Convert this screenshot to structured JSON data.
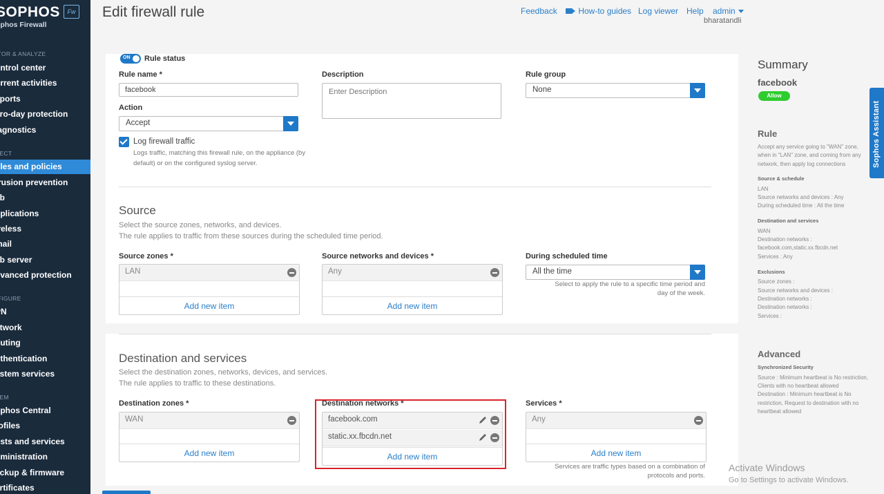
{
  "sidebar": {
    "brand": "SOPHOS",
    "badge": "Fw",
    "subtitle": "ophos Firewall",
    "sections": [
      "ITOR & ANALYZE",
      "TECT",
      "IFIGURE",
      "TEM"
    ],
    "items": [
      "ontrol center",
      "urrent activities",
      "eports",
      "ero-day protection",
      "iagnostics",
      "ules and policies",
      "trusion prevention",
      "eb",
      "pplications",
      "ireless",
      "mail",
      "eb server",
      "dvanced protection",
      "PN",
      "etwork",
      "outing",
      "uthentication",
      "ystem services",
      "ophos Central",
      "rofiles",
      "osts and services",
      "dministration",
      "ackup & firmware",
      "ertificates"
    ]
  },
  "header": {
    "title": "Edit firewall rule",
    "feedback": "Feedback",
    "howto": "How-to guides",
    "logviewer": "Log viewer",
    "help": "Help",
    "user": "admin",
    "usersub": "bharatandli"
  },
  "rule": {
    "toggle_text": "ON",
    "status_label": "Rule status",
    "name_label": "Rule name *",
    "name_value": "facebook",
    "desc_label": "Description",
    "desc_placeholder": "Enter Description",
    "group_label": "Rule group",
    "group_value": "None",
    "action_label": "Action",
    "action_value": "Accept",
    "log_label": "Log firewall traffic",
    "log_desc_1": "Logs traffic, matching this firewall rule, on the appliance (by",
    "log_desc_2": "default) or on the configured syslog server."
  },
  "source": {
    "title": "Source",
    "desc1": "Select the source zones, networks, and devices.",
    "desc2": "The rule applies to traffic from these sources during the scheduled time period.",
    "zones_label": "Source zones *",
    "zones_value": "LAN",
    "networks_label": "Source networks and devices *",
    "networks_value": "Any",
    "schedule_label": "During scheduled time",
    "schedule_value": "All the time",
    "schedule_help_1": "Select to apply the rule to a specific time period and",
    "schedule_help_2": "day of the week.",
    "add_item": "Add new item"
  },
  "destination": {
    "title": "Destination and services",
    "desc1": "Select the destination zones, networks, devices, and services.",
    "desc2": "The rule applies to traffic to these destinations.",
    "zones_label": "Destination zones *",
    "zones_value": "WAN",
    "networks_label": "Destination networks *",
    "networks": [
      "facebook.com",
      "static.xx.fbcdn.net"
    ],
    "services_label": "Services *",
    "services_value": "Any",
    "services_help_1": "Services are traffic types based on a combination of",
    "services_help_2": "protocols and ports.",
    "add_item": "Add new item"
  },
  "summary": {
    "title": "Summary",
    "name": "facebook",
    "badge": "Allow",
    "rule_heading": "Rule",
    "rule_text": [
      "Accept any service going to \"WAN\" zone,",
      "when in \"LAN\" zone, and coming from any",
      "network, then apply log connections"
    ],
    "src_heading": "Source & schedule",
    "src_text": [
      "LAN",
      "Source networks and devices : Any",
      "During scheduled time : All the time"
    ],
    "dst_heading": "Destination and services",
    "dst_text": [
      "WAN",
      "Destination networks :",
      "facebook.com,static.xx.fbcdn.net",
      "Services : Any"
    ],
    "excl_heading": "Exclusions",
    "excl_text": [
      "Source zones :",
      "Source networks and devices :",
      "Destination networks :",
      "Destination networks :",
      "Services :"
    ],
    "adv_heading": "Advanced",
    "sync_heading": "Synchronized Security",
    "sync_text": [
      "Source : Minimum heartbeat is No restriction,",
      "Clients with no heartbeat allowed",
      "Destination : Minimum heartbeat is No",
      "restriction, Request to destination with no",
      "heartbeat allowed"
    ]
  },
  "assistant": "Sophos Assistant",
  "watermark": {
    "line1": "Activate Windows",
    "line2": "Go to Settings to activate Windows."
  },
  "colors": {
    "sidebar_bg": "#1a2b3c",
    "accent": "#1f78c8",
    "allow": "#2ecc2e",
    "highlight": "#d9232a"
  }
}
